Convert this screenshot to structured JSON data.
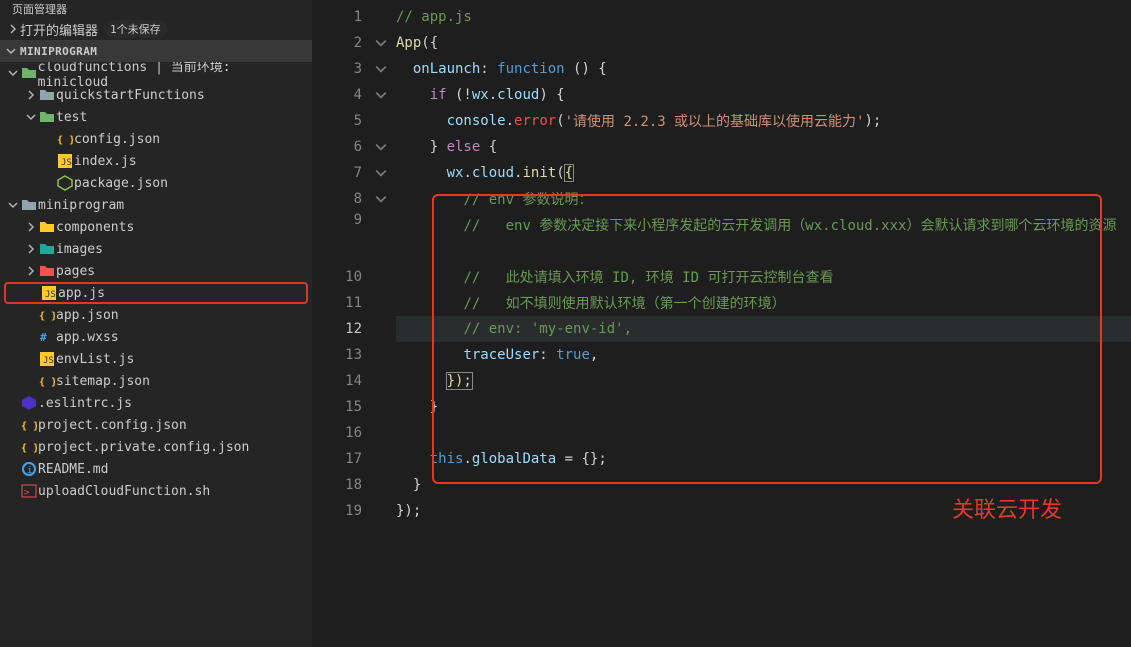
{
  "sidebar": {
    "title_garbled": "页面管理器",
    "open_editors": "打开的编辑器",
    "unsaved_badge": "1个未保存",
    "root": "MINIPROGRAM",
    "items": [
      {
        "label": "cloudfunctions | 当前环境: minicloud",
        "icon": "folder-cloud",
        "indent": 0,
        "expand": "open"
      },
      {
        "label": "quickstartFunctions",
        "icon": "folder",
        "indent": 1,
        "expand": "closed"
      },
      {
        "label": "test",
        "icon": "folder-cloud",
        "indent": 1,
        "expand": "open"
      },
      {
        "label": "config.json",
        "icon": "json",
        "indent": 2
      },
      {
        "label": "index.js",
        "icon": "js",
        "indent": 2
      },
      {
        "label": "package.json",
        "icon": "node",
        "indent": 2
      },
      {
        "label": "miniprogram",
        "icon": "folder",
        "indent": 0,
        "expand": "open"
      },
      {
        "label": "components",
        "icon": "folder-comp",
        "indent": 1,
        "expand": "closed"
      },
      {
        "label": "images",
        "icon": "folder-img",
        "indent": 1,
        "expand": "closed"
      },
      {
        "label": "pages",
        "icon": "folder-pages",
        "indent": 1,
        "expand": "closed"
      },
      {
        "label": "app.js",
        "icon": "js",
        "indent": 1,
        "selected": true
      },
      {
        "label": "app.json",
        "icon": "json",
        "indent": 1
      },
      {
        "label": "app.wxss",
        "icon": "wxss",
        "indent": 1
      },
      {
        "label": "envList.js",
        "icon": "js",
        "indent": 1
      },
      {
        "label": "sitemap.json",
        "icon": "json",
        "indent": 1
      },
      {
        "label": ".eslintrc.js",
        "icon": "eslint",
        "indent": 0
      },
      {
        "label": "project.config.json",
        "icon": "json",
        "indent": 0
      },
      {
        "label": "project.private.config.json",
        "icon": "json",
        "indent": 0
      },
      {
        "label": "README.md",
        "icon": "md",
        "indent": 0
      },
      {
        "label": "uploadCloudFunction.sh",
        "icon": "sh",
        "indent": 0
      }
    ]
  },
  "code": {
    "c1": "// app.js",
    "l2_app": "App",
    "l2_paren": "({",
    "l3_on": "onLaunch",
    "l3_sep": ": ",
    "l3_fn": "function",
    "l3_rest": " () {",
    "l4_if": "if",
    "l4_par": " (!",
    "l4_wx": "wx",
    "l4_dot": ".",
    "l4_cloud": "cloud",
    "l4_end": ") {",
    "l5_c": "console",
    "l5_d": ".",
    "l5_e": "error",
    "l5_p1": "(",
    "l5_str": "'请使用 2.2.3 或以上的基础库以使用云能力'",
    "l5_p2": ");",
    "l6_brace": "} ",
    "l6_else": "else",
    "l6_open": " {",
    "l7_wx": "wx",
    "l7_d1": ".",
    "l7_cloud": "cloud",
    "l7_d2": ".",
    "l7_init": "init",
    "l7_p1": "(",
    "l7_brace": "{",
    "c8": "// env 参数说明：",
    "c9": "//   env 参数决定接下来小程序发起的云开发调用（wx.cloud.xxx）会默认请求到哪个云环境的资源",
    "c10": "//   此处请填入环境 ID, 环境 ID 可打开云控制台查看",
    "c11": "//   如不填则使用默认环境（第一个创建的环境）",
    "c12": "// env: 'my-env-id',",
    "l13_k": "traceUser",
    "l13_sep": ": ",
    "l13_v": "true",
    "l13_c": ",",
    "l14_close": "});",
    "l15_close": "}",
    "l17_this": "this",
    "l17_dot": ".",
    "l17_g": "globalData",
    "l17_rest": " = {};",
    "l18_close": "}",
    "l19_close": "});"
  },
  "annotation": "关联云开发"
}
